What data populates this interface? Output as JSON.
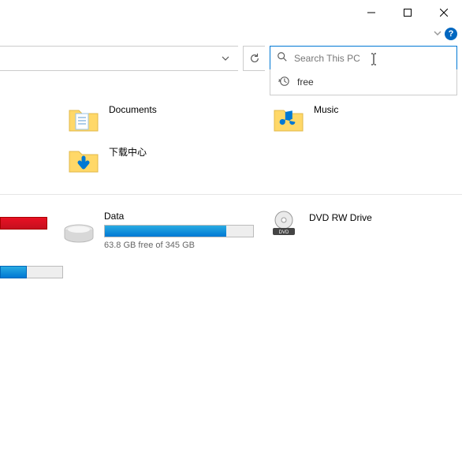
{
  "window": {
    "minimize_tooltip": "Minimize",
    "maximize_tooltip": "Maximize",
    "close_tooltip": "Close",
    "help_tooltip": "?"
  },
  "search": {
    "placeholder": "Search This PC",
    "value": "",
    "suggestions": [
      {
        "text": "free",
        "type": "history"
      }
    ]
  },
  "folders": [
    {
      "name": "Documents",
      "icon": "documents"
    },
    {
      "name": "Music",
      "icon": "music"
    },
    {
      "name": "下载中心",
      "icon": "downloads"
    }
  ],
  "drives": {
    "partial_left": {
      "color": "red"
    },
    "data": {
      "name": "Data",
      "free_text": "63.8 GB free of 345 GB",
      "fill_percent": 82
    },
    "dvd": {
      "name": "DVD RW Drive"
    },
    "partial_blue": {
      "fill_percent": 42
    }
  }
}
